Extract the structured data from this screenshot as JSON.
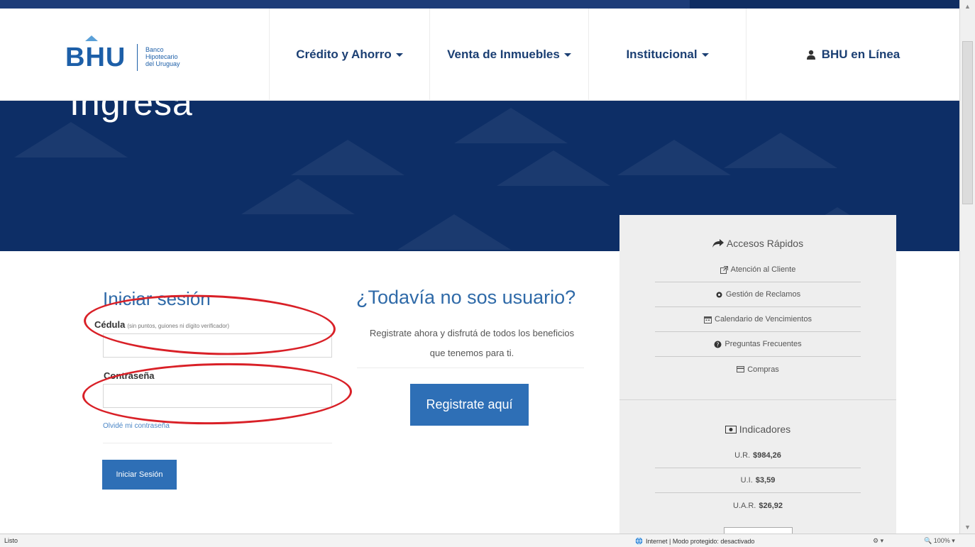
{
  "nav": {
    "logo": {
      "main": "BHU",
      "line1": "Banco",
      "line2": "Hipotecario",
      "line3": "del Uruguay"
    },
    "items": [
      {
        "label": "Crédito y Ahorro"
      },
      {
        "label": "Venta de Inmuebles"
      },
      {
        "label": "Institucional"
      }
    ],
    "bhu_online": "BHU en Línea"
  },
  "hero": {
    "title": "Ingresa"
  },
  "login": {
    "title": "Iniciar sesión",
    "cedula_label": "Cédula",
    "cedula_hint": "(sin puntos, guiones ni dígito verificador)",
    "cedula_value": "",
    "password_label": "Contraseña",
    "password_value": "",
    "forgot": "Olvidé mi contraseña",
    "submit": "Iniciar Sesión"
  },
  "register": {
    "title": "¿Todavía no sos usuario?",
    "text": "Registrate ahora y disfrutá de todos los beneficios que tenemos para ti.",
    "button": "Registrate aquí"
  },
  "quick_access": {
    "title": "Accesos Rápidos",
    "items": [
      {
        "label": "Atención al Cliente",
        "icon": "external-link-icon"
      },
      {
        "label": "Gestión de Reclamos",
        "icon": "gear-icon"
      },
      {
        "label": "Calendario de Vencimientos",
        "icon": "calendar-icon"
      },
      {
        "label": "Preguntas Frecuentes",
        "icon": "question-icon"
      },
      {
        "label": "Compras",
        "icon": "credit-card-icon"
      }
    ]
  },
  "indicators": {
    "title": "Indicadores",
    "items": [
      {
        "label": "U.R.",
        "value": "$984,26"
      },
      {
        "label": "U.I.",
        "value": "$3,59"
      },
      {
        "label": "U.A.R.",
        "value": "$26,92"
      }
    ]
  },
  "statusbar": {
    "left": "Listo",
    "zone": "Internet | Modo protegido: desactivado",
    "zoom": "100%"
  },
  "colors": {
    "brand": "#1d5fa8",
    "hero": "#0d2e66",
    "button": "#2e6fb6",
    "annotation": "#d92027"
  }
}
